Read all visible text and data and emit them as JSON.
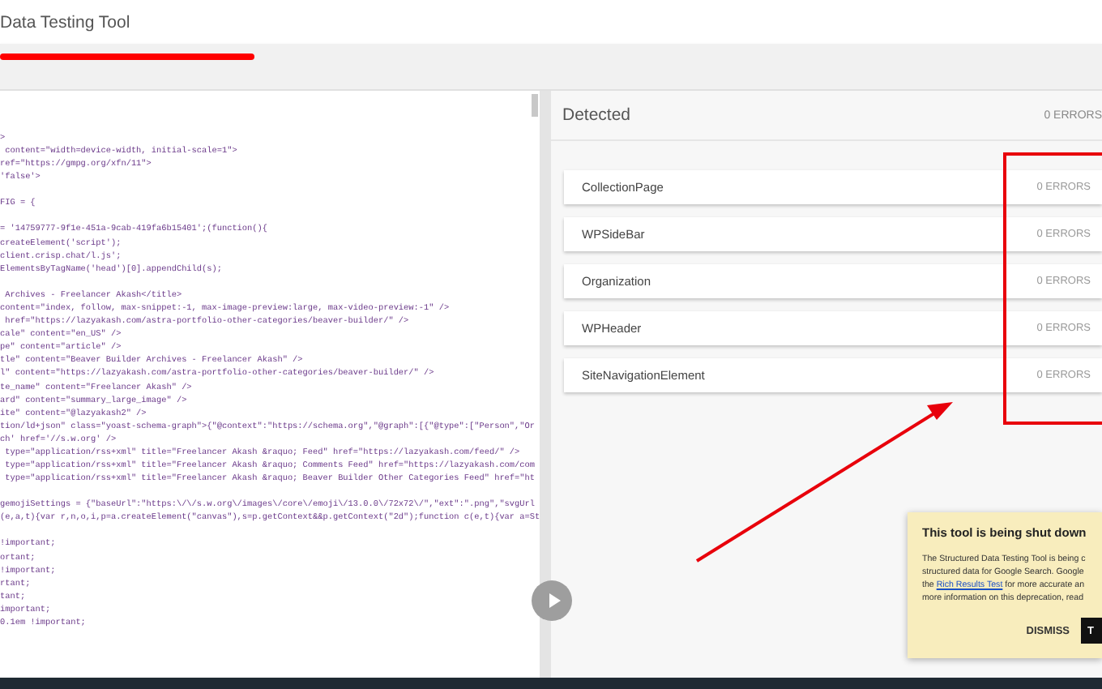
{
  "header": {
    "title": "Data Testing Tool"
  },
  "code_blocks": [
    {
      "lines": [
        ">",
        " content=\"width=device-width, initial-scale=1\">",
        "ref=\"https://gmpg.org/xfn/11\">",
        "'false'>"
      ]
    },
    {
      "lines": [
        "FIG = {"
      ]
    },
    {
      "lines": [
        "= '14759777-9f1e-451a-9cab-419fa6b15401';(function(){",
        "createElement('script');",
        "client.crisp.chat/l.js';",
        "ElementsByTagName('head')[0].appendChild(s);"
      ]
    },
    {
      "lines": [
        " Archives - Freelancer Akash</title>",
        "content=\"index, follow, max-snippet:-1, max-image-preview:large, max-video-preview:-1\" />",
        " href=\"https://lazyakash.com/astra-portfolio-other-categories/beaver-builder/\" />",
        "cale\" content=\"en_US\" />",
        "pe\" content=\"article\" />",
        "tle\" content=\"Beaver Builder Archives - Freelancer Akash\" />",
        "l\" content=\"https://lazyakash.com/astra-portfolio-other-categories/beaver-builder/\" />",
        "te_name\" content=\"Freelancer Akash\" />",
        "ard\" content=\"summary_large_image\" />",
        "ite\" content=\"@lazyakash2\" />",
        "tion/ld+json\" class=\"yoast-schema-graph\">{\"@context\":\"https://schema.org\",\"@graph\":[{\"@type\":[\"Person\",\"Or",
        "ch' href='//s.w.org' />",
        " type=\"application/rss+xml\" title=\"Freelancer Akash &raquo; Feed\" href=\"https://lazyakash.com/feed/\" />",
        " type=\"application/rss+xml\" title=\"Freelancer Akash &raquo; Comments Feed\" href=\"https://lazyakash.com/com",
        " type=\"application/rss+xml\" title=\"Freelancer Akash &raquo; Beaver Builder Other Categories Feed\" href=\"ht"
      ]
    },
    {
      "lines": [
        "gemojiSettings = {\"baseUrl\":\"https:\\/\\/s.w.org\\/images\\/core\\/emoji\\/13.0.0\\/72x72\\/\",\"ext\":\".png\",\"svgUrl",
        "(e,a,t){var r,n,o,i,p=a.createElement(\"canvas\"),s=p.getContext&&p.getContext(\"2d\");function c(e,t){var a=St"
      ]
    },
    {
      "lines": [
        "!important;",
        "ortant;",
        "!important;",
        "rtant;",
        "tant;",
        "important;",
        "0.1em !important;"
      ]
    }
  ],
  "detected": {
    "title": "Detected",
    "errors": "0 ERRORS",
    "items": [
      {
        "name": "CollectionPage",
        "errors": "0 ERRORS"
      },
      {
        "name": "WPSideBar",
        "errors": "0 ERRORS"
      },
      {
        "name": "Organization",
        "errors": "0 ERRORS"
      },
      {
        "name": "WPHeader",
        "errors": "0 ERRORS"
      },
      {
        "name": "SiteNavigationElement",
        "errors": "0 ERRORS"
      }
    ]
  },
  "notice": {
    "title": "This tool is being shut down",
    "body_before": "The Structured Data Testing Tool is being c\nstructured data for Google Search. Google\nthe ",
    "link": "Rich Results Test",
    "body_after": " for more accurate an\nmore information on this deprecation, read",
    "buttons": [
      {
        "label": "DISMISS",
        "kind": "text"
      },
      {
        "label": "T",
        "kind": "filled"
      }
    ]
  }
}
